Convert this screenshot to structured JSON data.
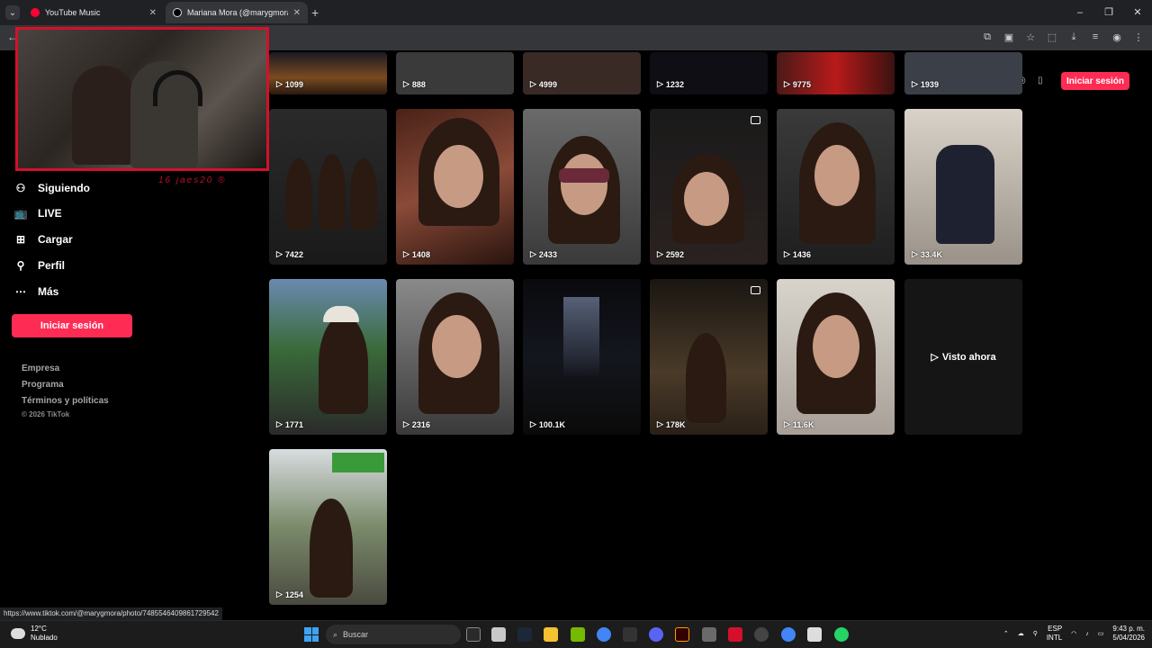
{
  "browser": {
    "tabs": [
      {
        "title": "YouTube Music",
        "color": "#ff0033"
      },
      {
        "title": "Mariana Mora (@marygmora) |",
        "color": "#000000"
      }
    ]
  },
  "stream": {
    "overlay_text": "16 jaes20 ®"
  },
  "sidebar": {
    "items": [
      {
        "label": "Siguiendo",
        "icon": "person-plus-icon"
      },
      {
        "label": "LIVE",
        "icon": "live-tv-icon"
      },
      {
        "label": "Cargar",
        "icon": "upload-plus-icon"
      },
      {
        "label": "Perfil",
        "icon": "person-icon"
      },
      {
        "label": "Más",
        "icon": "more-dots-icon"
      }
    ],
    "login_label": "Iniciar sesión",
    "footer_links": [
      "Empresa",
      "Programa",
      "Términos y políticas"
    ],
    "copyright": "© 2026 TikTok"
  },
  "header": {
    "login_label": "Iniciar sesión"
  },
  "videos": {
    "row0": [
      "1099",
      "888",
      "4999",
      "1232",
      "9775",
      "1939"
    ],
    "row1": [
      "7422",
      "1408",
      "2433",
      "2592",
      "1436",
      "33.4K"
    ],
    "row2": [
      "1771",
      "2316",
      "100.1K",
      "178K",
      "11.6K"
    ],
    "row3": [
      "1254"
    ],
    "watched_label": "Visto ahora",
    "accent": "#fe2c55"
  },
  "status_bar": {
    "url": "https://www.tiktok.com/@marygmora/photo/7485546409861729542"
  },
  "taskbar": {
    "weather_temp": "12°C",
    "weather_desc": "Nublado",
    "search_placeholder": "Buscar",
    "lang": "ESP",
    "layout": "INTL",
    "time": "9:43 p. m.",
    "date": "5/04/2026"
  }
}
